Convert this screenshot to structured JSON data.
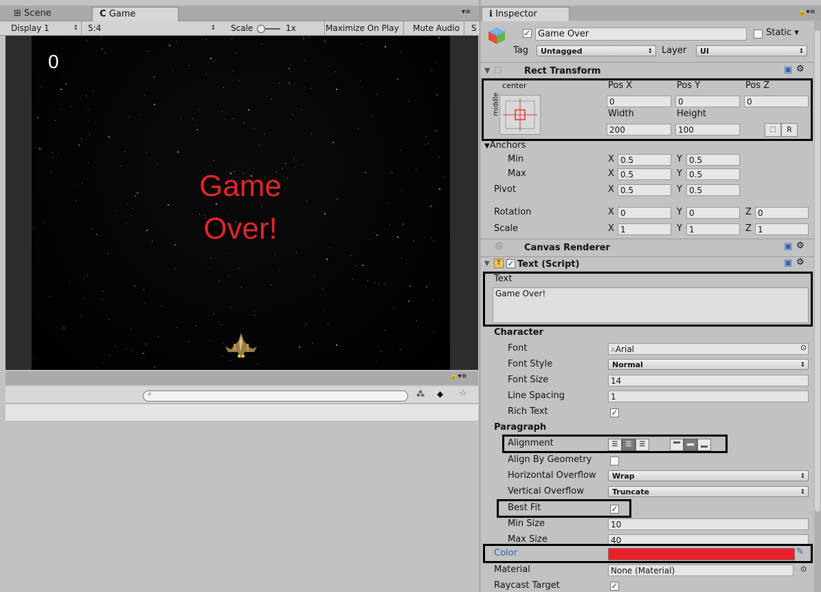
{
  "left_panel": {
    "tabs": [
      "Scene",
      "Game"
    ],
    "toolbar": {
      "display": "Display 1",
      "aspect": "5:4",
      "scale_label": "Scale",
      "scale_value": "1x",
      "maximize_on_play": "Maximize On Play",
      "mute_audio": "Mute Audio",
      "stats_partial": "S"
    },
    "game": {
      "score": "0",
      "game_over_line1": "Game",
      "game_over_line2": "Over!"
    },
    "search": {
      "placeholder": ""
    }
  },
  "inspector": {
    "tab": "Inspector",
    "object_name": "Game Over",
    "static_label": "Static",
    "tag_label": "Tag",
    "tag_value": "Untagged",
    "layer_label": "Layer",
    "layer_value": "UI",
    "rect_transform": {
      "title": "Rect Transform",
      "anchor_h": "center",
      "anchor_v": "middle",
      "pos_x_label": "Pos X",
      "pos_y_label": "Pos Y",
      "pos_z_label": "Pos Z",
      "pos_x": "0",
      "pos_y": "0",
      "pos_z": "0",
      "width_label": "Width",
      "height_label": "Height",
      "width": "200",
      "height": "100",
      "r_button": "R",
      "anchors_label": "Anchors",
      "min_label": "Min",
      "max_label": "Max",
      "min_x": "0.5",
      "min_y": "0.5",
      "max_x": "0.5",
      "max_y": "0.5",
      "pivot_label": "Pivot",
      "pivot_x": "0.5",
      "pivot_y": "0.5",
      "rotation_label": "Rotation",
      "rot_x": "0",
      "rot_y": "0",
      "rot_z": "0",
      "scale_label": "Scale",
      "scale_x": "1",
      "scale_y": "1",
      "scale_z": "1",
      "x": "X",
      "y": "Y",
      "z": "Z"
    },
    "canvas_renderer": {
      "title": "Canvas Renderer"
    },
    "text_script": {
      "title": "Text (Script)",
      "text_label": "Text",
      "text_value": "Game Over!",
      "character_label": "Character",
      "font_label": "Font",
      "font_value": "Arial",
      "font_style_label": "Font Style",
      "font_style_value": "Normal",
      "font_size_label": "Font Size",
      "font_size_value": "14",
      "line_spacing_label": "Line Spacing",
      "line_spacing_value": "1",
      "rich_text_label": "Rich Text",
      "paragraph_label": "Paragraph",
      "alignment_label": "Alignment",
      "align_by_geometry_label": "Align By Geometry",
      "h_overflow_label": "Horizontal Overflow",
      "h_overflow_value": "Wrap",
      "v_overflow_label": "Vertical Overflow",
      "v_overflow_value": "Truncate",
      "best_fit_label": "Best Fit",
      "min_size_label": "Min Size",
      "min_size_value": "10",
      "max_size_label": "Max Size",
      "max_size_value": "40",
      "color_label": "Color",
      "color_value": "#e8202a",
      "material_label": "Material",
      "material_value": "None (Material)",
      "raycast_label": "Raycast Target"
    }
  },
  "colors": {
    "game_over_text": "#e0252a",
    "highlight_border": "#000000",
    "color_swatch": "#e8202a"
  }
}
